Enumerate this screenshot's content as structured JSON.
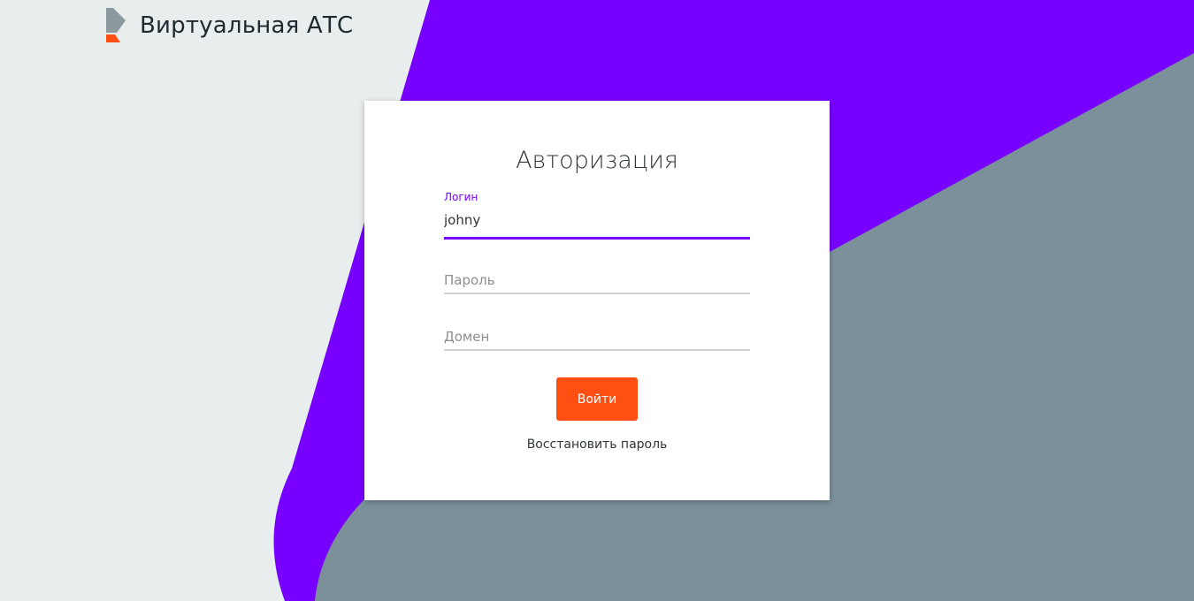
{
  "header": {
    "logo_icon": "rostelecom-logo-icon",
    "app_title": "Виртуальная АТС"
  },
  "login_form": {
    "title": "Авторизация",
    "login": {
      "label": "Логин",
      "value": "johny"
    },
    "password": {
      "placeholder": "Пароль",
      "value": ""
    },
    "domain": {
      "placeholder": "Домен",
      "value": ""
    },
    "submit_label": "Войти",
    "restore_password_label": "Восстановить пароль"
  },
  "colors": {
    "accent_purple": "#7700ff",
    "accent_orange": "#ff4f12",
    "background_light": "#e8edee",
    "background_gray": "#7b9099",
    "logo_gray": "#8c9aa0"
  }
}
